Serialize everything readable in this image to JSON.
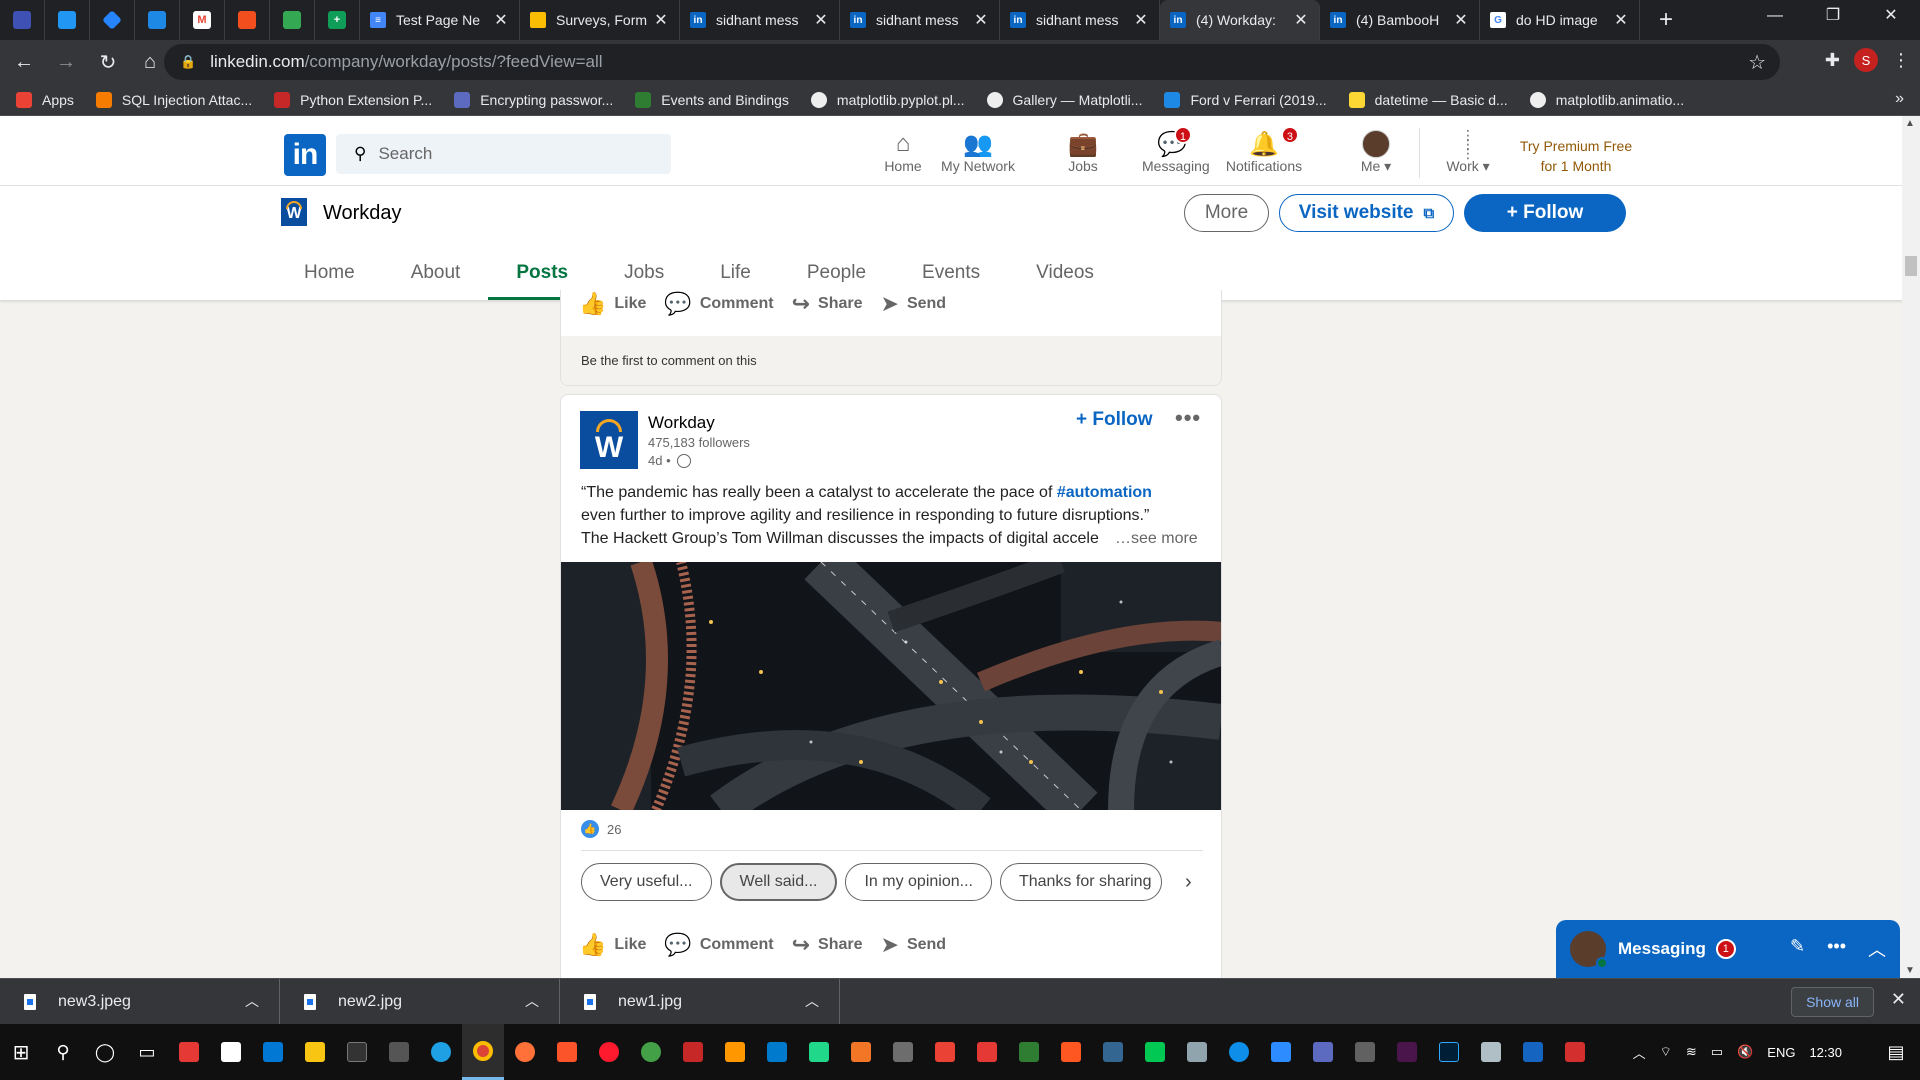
{
  "browser": {
    "tabs": [
      {
        "label": "Test Page Ne",
        "color": "#4285f4",
        "fav": "≡"
      },
      {
        "label": "Surveys, Form",
        "color": "#fbbc04",
        "fav": ""
      },
      {
        "label": "sidhant mess",
        "color": "#0a66c2",
        "fav": "in"
      },
      {
        "label": "sidhant mess",
        "color": "#0a66c2",
        "fav": "in"
      },
      {
        "label": "sidhant mess",
        "color": "#0a66c2",
        "fav": "in"
      },
      {
        "label": "(4) Workday:",
        "color": "#0a66c2",
        "fav": "in"
      },
      {
        "label": "(4) BambooH",
        "color": "#0a66c2",
        "fav": "in"
      },
      {
        "label": "do HD image",
        "color": "#ffffff",
        "fav": "G"
      }
    ],
    "url_host": "linkedin.com",
    "url_path": "/company/workday/posts/?feedView=all",
    "profile_initial": "S",
    "bookmarks": [
      {
        "label": "Apps",
        "color": "#ea4335"
      },
      {
        "label": "SQL Injection Attac...",
        "color": "#f57c00"
      },
      {
        "label": "Python Extension P...",
        "color": "#c62828"
      },
      {
        "label": "Encrypting passwor...",
        "color": "#5c6bc0"
      },
      {
        "label": "Events and Bindings",
        "color": "#2e7d32"
      },
      {
        "label": "matplotlib.pyplot.pl...",
        "color": "#eeeeee"
      },
      {
        "label": "Gallery — Matplotli...",
        "color": "#eeeeee"
      },
      {
        "label": "Ford v Ferrari (2019...",
        "color": "#1e88e5"
      },
      {
        "label": "datetime — Basic d...",
        "color": "#fdd835"
      },
      {
        "label": "matplotlib.animatio...",
        "color": "#eeeeee"
      }
    ],
    "bookmarks_more": "»"
  },
  "linkedin": {
    "logo": "in",
    "search_placeholder": "Search",
    "nav": [
      {
        "label": "Home",
        "icon": "⌂",
        "badge": ""
      },
      {
        "label": "My Network",
        "icon": "👥",
        "badge": ""
      },
      {
        "label": "Jobs",
        "icon": "💼",
        "badge": ""
      },
      {
        "label": "Messaging",
        "icon": "💬",
        "badge": "1"
      },
      {
        "label": "Notifications",
        "icon": "🔔",
        "badge": "3"
      },
      {
        "label": "Me ▾",
        "icon": "",
        "badge": ""
      },
      {
        "label": "Work ▾",
        "icon": "⋮⋮⋮",
        "badge": ""
      }
    ],
    "premium_line1": "Try Premium Free",
    "premium_line2": "for 1 Month"
  },
  "company": {
    "logo_letter": "W",
    "name": "Workday",
    "more": "More",
    "visit": "Visit website",
    "follow": "+ Follow",
    "tabs": [
      "Home",
      "About",
      "Posts",
      "Jobs",
      "Life",
      "People",
      "Events",
      "Videos"
    ],
    "active_tab": "Posts"
  },
  "feed": {
    "prev_actions": [
      "Like",
      "Comment",
      "Share",
      "Send"
    ],
    "first_comment": "Be the first to comment on this",
    "post": {
      "author": "Workday",
      "followers": "475,183 followers",
      "time": "4d •",
      "follow": "+ Follow",
      "dots": "•••",
      "text_pre": "“The pandemic has really been a catalyst to accelerate the pace of ",
      "hashtag": "#automation",
      "text_line2": "even further to improve agility and resilience in responding to future disruptions.”",
      "text_line3": "The Hackett Group’s Tom Willman discusses the impacts of digital accele",
      "see_more": "…see more",
      "reaction_count": "26",
      "suggestions": [
        "Very useful...",
        "Well said...",
        "In my opinion...",
        "Thanks for sharing"
      ],
      "suggestion_next": "›",
      "actions": [
        "Like",
        "Comment",
        "Share",
        "Send"
      ]
    }
  },
  "messaging": {
    "title": "Messaging",
    "badge": "1"
  },
  "downloads": {
    "items": [
      "new3.jpeg",
      "new2.jpg",
      "new1.jpg"
    ],
    "show_all": "Show all",
    "close": "✕"
  },
  "taskbar": {
    "lang": "ENG",
    "time": "12:30"
  }
}
